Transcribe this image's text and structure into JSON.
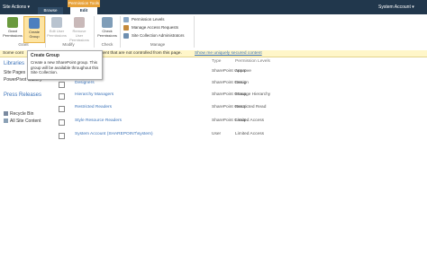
{
  "topbar": {
    "site_actions": "Site Actions ▾",
    "context_group": "Permission Tools",
    "tab_browse": "Browse",
    "tab_edit": "Edit",
    "account": "System Account ▾"
  },
  "ribbon": {
    "grant_label": "Grant Permissions",
    "create_group_label": "Create Group",
    "edit_user_label": "Edit User Permissions",
    "remove_user_label": "Remove User Permissions",
    "check_label": "Check Permissions",
    "group_grant": "Grant",
    "group_modify": "Modify",
    "group_check": "Check",
    "group_manage": "Manage",
    "permission_levels": "Permission Levels",
    "manage_access": "Manage Access Requests",
    "site_collection_admins": "Site Collection Administrators"
  },
  "banner": {
    "text": "Some cont",
    "text_tail": "tent that are not controlled from this page.",
    "link": "Show me uniquely secured content"
  },
  "tooltip": {
    "title": "Create Group",
    "body": "Create a new SharePoint group. This group will be available throughout this Site Collection."
  },
  "nav": {
    "libraries": "Libraries",
    "site_pages": "Site Pages",
    "powerpivot": "PowerPivot Gallery",
    "press_releases": "Press Releases",
    "recycle_bin": "Recycle Bin",
    "all_site_content": "All Site Content"
  },
  "table": {
    "col_type": "Type",
    "col_perm": "Permission Levels",
    "rows": [
      {
        "name": "",
        "type": "SharePoint Group",
        "perm": "Approve"
      },
      {
        "name": "Designers",
        "type": "SharePoint Group",
        "perm": "Design"
      },
      {
        "name": "Hierarchy Managers",
        "type": "SharePoint Group",
        "perm": "Manage Hierarchy"
      },
      {
        "name": "Restricted Readers",
        "type": "SharePoint Group",
        "perm": "Restricted Read"
      },
      {
        "name": "Style Resource Readers",
        "type": "SharePoint Group",
        "perm": "Limited Access"
      },
      {
        "name": "System Account (SHAREPOINT\\system)",
        "type": "User",
        "perm": "Limited Access"
      }
    ]
  },
  "colors": {
    "topbar": "#21374c",
    "context": "#e8a23a",
    "link": "#3b73b9",
    "banner": "#fff6c9"
  }
}
